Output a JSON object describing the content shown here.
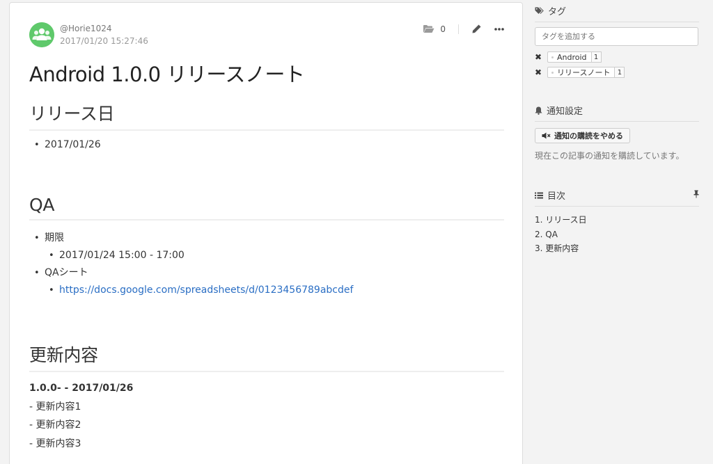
{
  "article": {
    "author": "@Horie1024",
    "timestamp": "2017/01/20 15:27:46",
    "folder_count": "0",
    "title": "Android 1.0.0 リリースノート",
    "sections": [
      {
        "heading": "リリース日",
        "items": [
          "2017/01/26"
        ]
      },
      {
        "heading": "QA",
        "items": [
          {
            "label": "期限",
            "sub": [
              "2017/01/24 15:00 - 17:00"
            ]
          },
          {
            "label": "QAシート",
            "sub": [
              "https://docs.google.com/spreadsheets/d/0123456789abcdef"
            ]
          }
        ]
      },
      {
        "heading": "更新内容",
        "bold_line": "1.0.0- - 2017/01/26",
        "lines": [
          "- 更新内容1",
          "- 更新内容2",
          "- 更新内容3"
        ]
      }
    ]
  },
  "sidebar": {
    "tags": {
      "heading": "タグ",
      "input_placeholder": "タグを追加する",
      "items": [
        {
          "name": "Android",
          "count": "1"
        },
        {
          "name": "リリースノート",
          "count": "1"
        }
      ]
    },
    "notify": {
      "heading": "通知設定",
      "button_label": "通知の購読をやめる",
      "status": "現在この記事の通知を購読しています。"
    },
    "toc": {
      "heading": "目次",
      "items": [
        "1. リリース日",
        "2. QA",
        "3. 更新内容"
      ]
    }
  },
  "colors": {
    "link": "#2a6ec4",
    "avatar": "#5fc96b",
    "background": "#f3f3f3"
  }
}
